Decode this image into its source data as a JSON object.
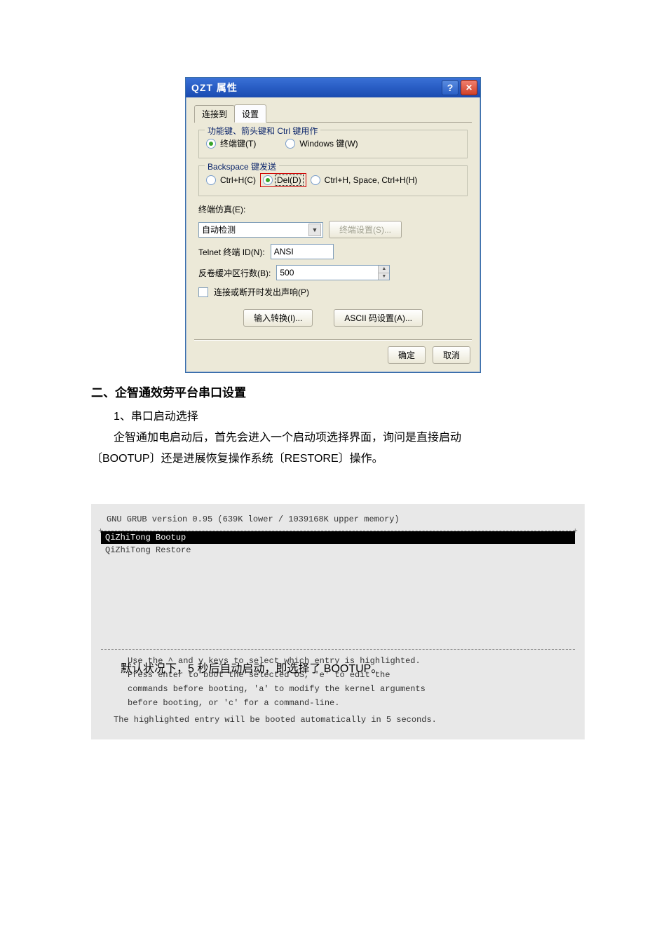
{
  "dialog": {
    "title": "QZT 属性",
    "tabs": {
      "connect": "连接到",
      "settings": "设置"
    },
    "group_fnkeys": {
      "legend": "功能键、箭头键和 Ctrl 键用作",
      "opt_terminal": "终端键(T)",
      "opt_windows": "Windows 键(W)"
    },
    "group_backspace": {
      "legend": "Backspace 键发送",
      "opt_ctrlh": "Ctrl+H(C)",
      "opt_del": "Del(D)",
      "opt_space": "Ctrl+H, Space, Ctrl+H(H)"
    },
    "emulation_label": "终端仿真(E):",
    "emulation_value": "自动检测",
    "terminal_settings_btn": "终端设置(S)...",
    "telnet_label": "Telnet 终端 ID(N):",
    "telnet_value": "ANSI",
    "scrollback_label": "反卷缓冲区行数(B):",
    "scrollback_value": "500",
    "sound_label": "连接或断开时发出声响(P)",
    "input_trans_btn": "输入转换(I)...",
    "ascii_btn": "ASCII 码设置(A)...",
    "ok": "确定",
    "cancel": "取消",
    "help_glyph": "?"
  },
  "doc": {
    "heading": "二、企智通效劳平台串口设置",
    "sub1": "1、串口启动选择",
    "para1_a": "企智通加电启动后，首先会进入一个启动项选择界面，询问是直接启动",
    "para1_b": "〔BOOTUP〕还是进展恢复操作系统〔RESTORE〕操作。"
  },
  "grub": {
    "header": "GNU GRUB  version 0.95  (639K lower / 1039168K upper memory)",
    "entry_bootup": "QiZhiTong Bootup",
    "entry_restore": "QiZhiTong Restore",
    "hint1": "Use the ^ and v keys to select which entry is highlighted.",
    "hint2": "Press enter to boot the selected OS, 'e' to edit the",
    "hint3": "commands before booting, 'a' to modify the kernel arguments",
    "hint4": "before booting, or 'c' for a command-line.",
    "auto": "The highlighted entry will be booted automatically in 5 seconds.",
    "overlay": "默认状况下，5 秒后自动启动，即选择了 BOOTUP。"
  }
}
